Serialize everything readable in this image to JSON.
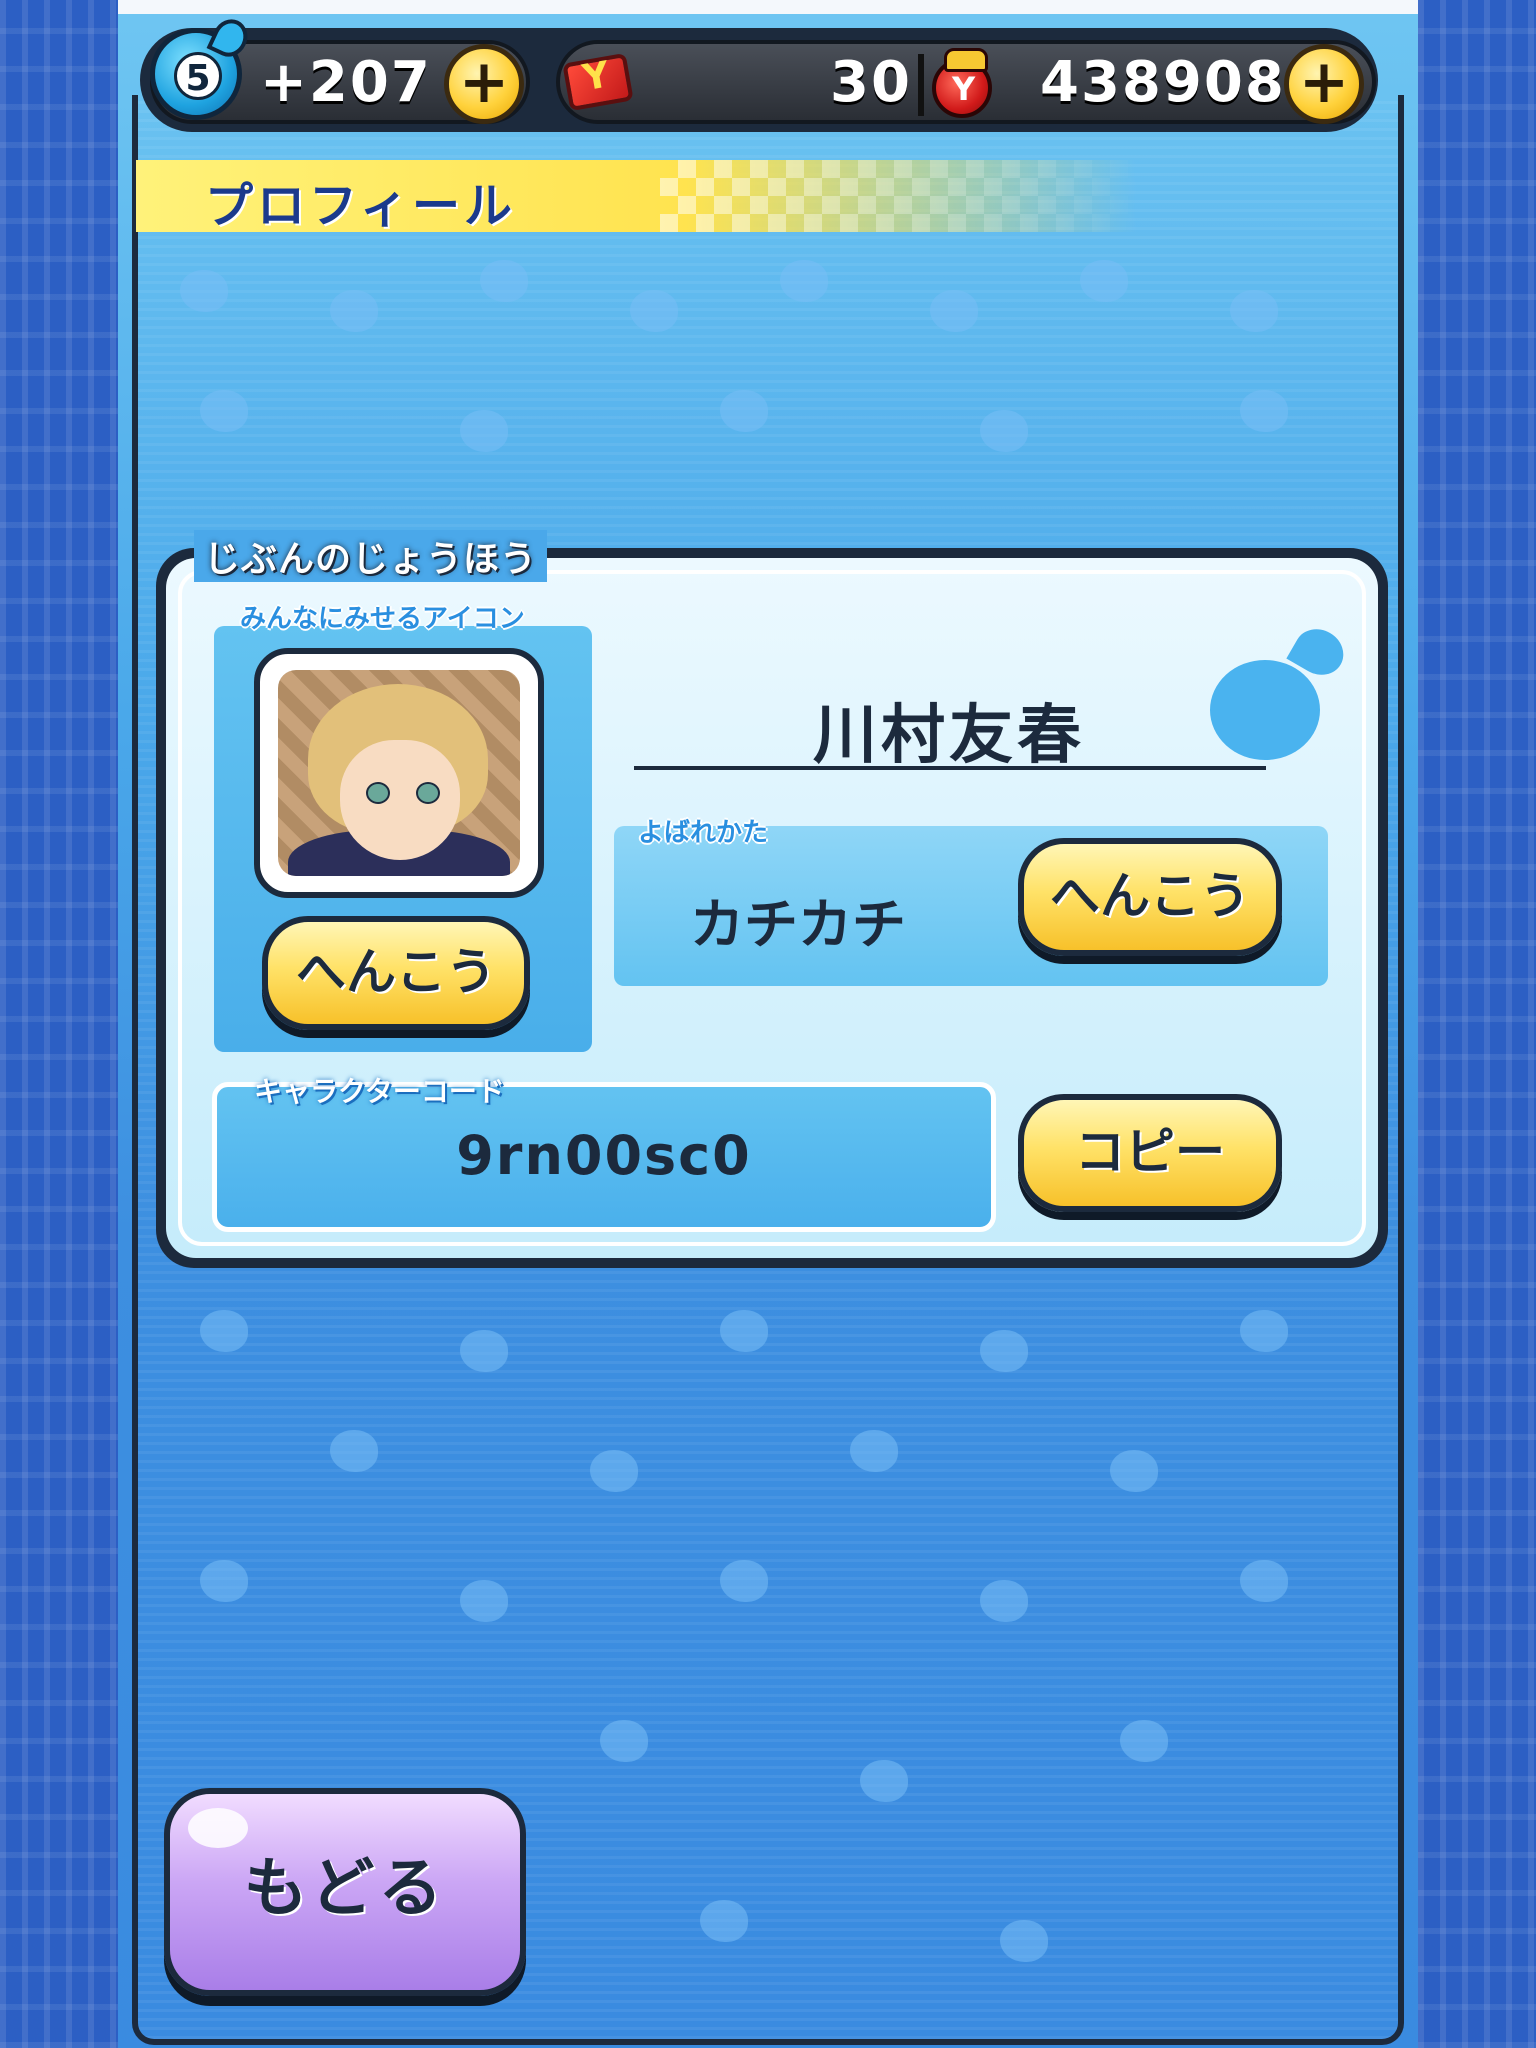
{
  "hud": {
    "level": "5",
    "stamina": "+207",
    "plus_label": "+",
    "tickets": "30",
    "money": "438908"
  },
  "page": {
    "title": "プロフィール"
  },
  "profile": {
    "section_label": "じぶんのじょうほう",
    "icon_label": "みんなにみせるアイコン",
    "change_label": "へんこう",
    "player_name": "川村友春",
    "nickname_label": "よばれかた",
    "nickname": "カチカチ",
    "code_label": "キャラクターコード",
    "code": "9rn00sc0",
    "copy_label": "コピー"
  },
  "footer": {
    "back_label": "もどる"
  },
  "colors": {
    "accent_yellow": "#ffe268",
    "panel_blue": "#63c3f1",
    "back_purple": "#cba6f5",
    "outline": "#1c2a3d"
  }
}
